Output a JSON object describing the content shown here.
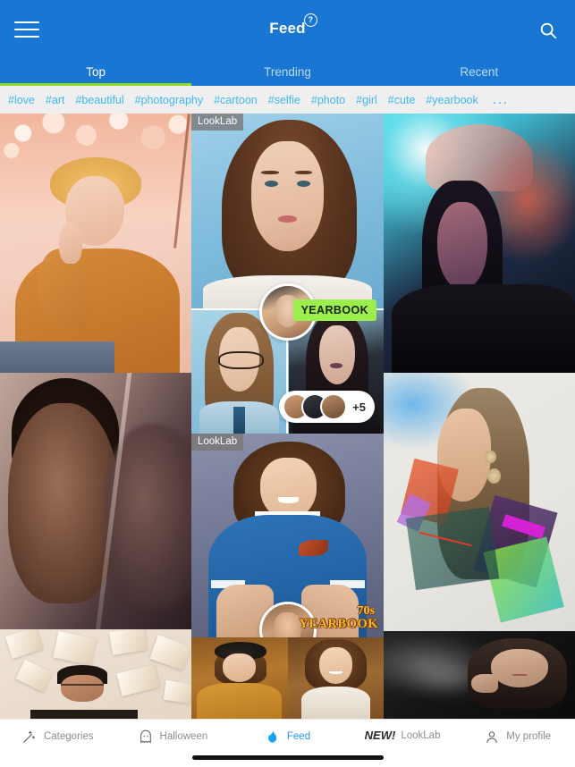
{
  "header": {
    "title": "Feed",
    "help_badge": "?",
    "menu_icon": "hamburger-menu-icon",
    "search_icon": "search-icon",
    "background_color": "#1976d2"
  },
  "tabs": {
    "items": [
      {
        "label": "Top",
        "active": true
      },
      {
        "label": "Trending",
        "active": false
      },
      {
        "label": "Recent",
        "active": false
      }
    ],
    "indicator_color": "#8bdc1c"
  },
  "hashtags": {
    "items": [
      "#love",
      "#art",
      "#beautiful",
      "#photography",
      "#cartoon",
      "#selfie",
      "#photo",
      "#girl",
      "#cute",
      "#yearbook"
    ],
    "more": "...",
    "link_color": "#3fb8f0",
    "background_color": "#efefef"
  },
  "feed": {
    "columns": [
      {
        "cards": [
          {
            "id": "autumn-illustration",
            "badge": null,
            "overlay": null
          },
          {
            "id": "dark-double-exposure",
            "badge": null,
            "overlay": null
          },
          {
            "id": "books-portrait",
            "badge": null,
            "overlay": null
          }
        ]
      },
      {
        "cards": [
          {
            "id": "looklab-yearbook-collage",
            "badge": "LookLab",
            "overlay": {
              "style_label": "YEARBOOK",
              "more_count": "+5"
            }
          },
          {
            "id": "looklab-70s-yearbook",
            "badge": "LookLab",
            "overlay": {
              "decade_label": "70s",
              "style_label": "YEARBOOK"
            }
          },
          {
            "id": "70s-duo-portraits",
            "badge": null,
            "overlay": null
          }
        ]
      },
      {
        "cards": [
          {
            "id": "neon-glitch-portrait",
            "badge": null,
            "overlay": null
          },
          {
            "id": "geometric-collage-portrait",
            "badge": null,
            "overlay": null
          },
          {
            "id": "bw-smoke-portrait",
            "badge": null,
            "overlay": null
          }
        ]
      }
    ]
  },
  "bottom_nav": {
    "items": [
      {
        "label": "Categories",
        "icon": "magic-wand-icon",
        "active": false,
        "tag": null
      },
      {
        "label": "Halloween",
        "icon": "ghost-icon",
        "active": false,
        "tag": null
      },
      {
        "label": "Feed",
        "icon": "flame-icon",
        "active": true,
        "tag": null
      },
      {
        "label": "LookLab",
        "icon": null,
        "active": false,
        "tag": "NEW!"
      },
      {
        "label": "My profile",
        "icon": "person-icon",
        "active": false,
        "tag": null
      }
    ],
    "active_color": "#2196f3"
  }
}
